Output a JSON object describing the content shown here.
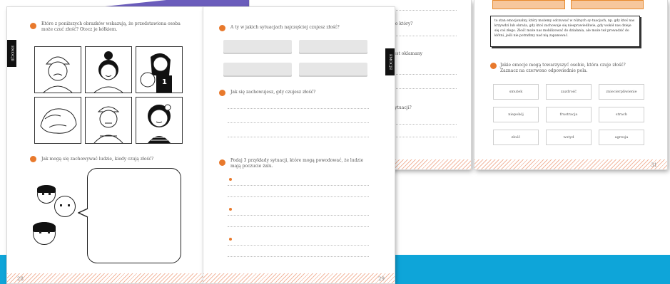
{
  "colors": {
    "accent": "#e8792c",
    "brand_blue": "#0ea5d9",
    "swoosh_purple": "#5b4bb5"
  },
  "back_right": {
    "note_text": "to stan emocjonalny, który możemy odczuwać w różnych sy-tuacjach, np. gdy ktoś nas krzywdzi lub obraża, gdy ktoś zachowuje się niesprawiedliwie, gdy wokół nas dzieje się coś złego. Złość może nas mobilizować do działania, ale może też prowadzić do kłótni, jeśli nie potrafimy nad nią zapanować.",
    "question": "Jakie emocje mogą towarzyszyć osobie, która czuje złość? Zaznacz na czerwono odpowiednie pola.",
    "words": [
      "smutek",
      "zazdrość",
      "zniecierpliwienie",
      "niepokój",
      "frustracja",
      "strach",
      "złość",
      "wstyd",
      "agresja"
    ],
    "page_num": "31"
  },
  "back_left": {
    "snippets": [
      "po który?",
      "jest oklamany",
      "sytuacji?"
    ]
  },
  "left_page": {
    "tab": "EMOCJE",
    "q1": "Które z poniższych obrazków wskazują, że przedstawiona osoba może czuć złość? Otocz je kółkiem.",
    "q2": "Jak mogą się zachowywać ludzie, kiedy czują złość?",
    "shirt_number": "1",
    "page_num": "28"
  },
  "right_page": {
    "tab": "EMOCJE",
    "q1": "A ty w jakich sytuacjach najczęściej czujesz złość?",
    "q2": "Jak się zachowujesz, gdy czujesz złość?",
    "q3": "Podaj 3 przykłady sytuacji, które mogą powodować, że ludzie mają poczucie żalu.",
    "page_num": "29"
  }
}
